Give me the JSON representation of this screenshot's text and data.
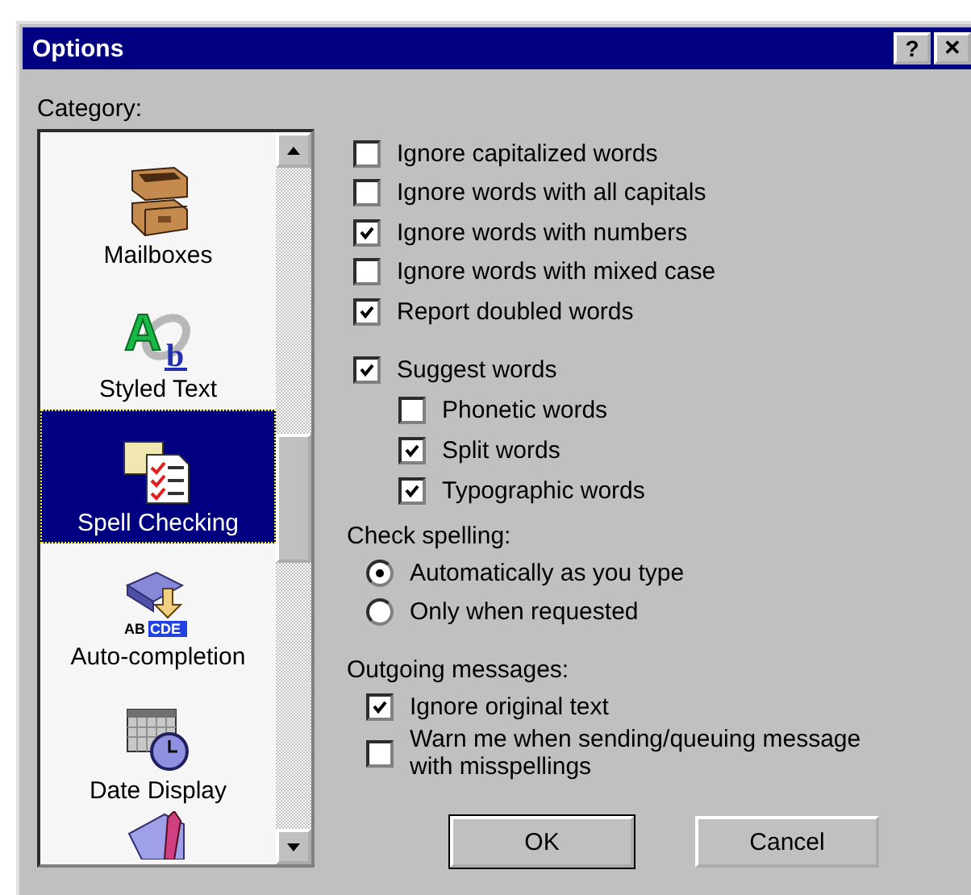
{
  "window": {
    "title": "Options",
    "controls": [
      {
        "kind": "help",
        "label": "?"
      },
      {
        "kind": "close",
        "label": "✕"
      }
    ]
  },
  "category": {
    "label": "Category:",
    "items": [
      {
        "kind": "mailboxes",
        "label": "Mailboxes",
        "selected": false
      },
      {
        "kind": "styled",
        "label": "Styled Text",
        "selected": false,
        "icon_text": [
          "A",
          "b"
        ]
      },
      {
        "kind": "spell",
        "label": "Spell Checking",
        "selected": true
      },
      {
        "kind": "completion",
        "label": "Auto-completion",
        "selected": false,
        "icon_text": [
          "AB",
          "CDE"
        ]
      },
      {
        "kind": "date",
        "label": "Date Display",
        "selected": false
      },
      {
        "kind": "tag",
        "selected": false
      }
    ]
  },
  "ignore_options": [
    {
      "label": "Ignore capitalized words",
      "checked": false
    },
    {
      "label": "Ignore words with all capitals",
      "checked": false
    },
    {
      "label": "Ignore words with numbers",
      "checked": true
    },
    {
      "label": "Ignore words with mixed case",
      "checked": false
    },
    {
      "label": "Report doubled words",
      "checked": true
    }
  ],
  "suggest": {
    "label": "Suggest words",
    "checked": true,
    "children": [
      {
        "label": "Phonetic words",
        "checked": false
      },
      {
        "label": "Split words",
        "checked": true
      },
      {
        "label": "Typographic words",
        "checked": true
      }
    ]
  },
  "check_spelling": {
    "label": "Check spelling:",
    "options": [
      {
        "label": "Automatically as you type",
        "selected": true
      },
      {
        "label": "Only when requested",
        "selected": false
      }
    ]
  },
  "outgoing": {
    "label": "Outgoing messages:",
    "options": [
      {
        "label": "Ignore original text",
        "checked": true
      },
      {
        "label": "Warn me when sending/queuing message with misspellings",
        "checked": false
      }
    ]
  },
  "buttons": [
    {
      "label": "OK",
      "default": true
    },
    {
      "label": "Cancel",
      "default": false
    }
  ]
}
